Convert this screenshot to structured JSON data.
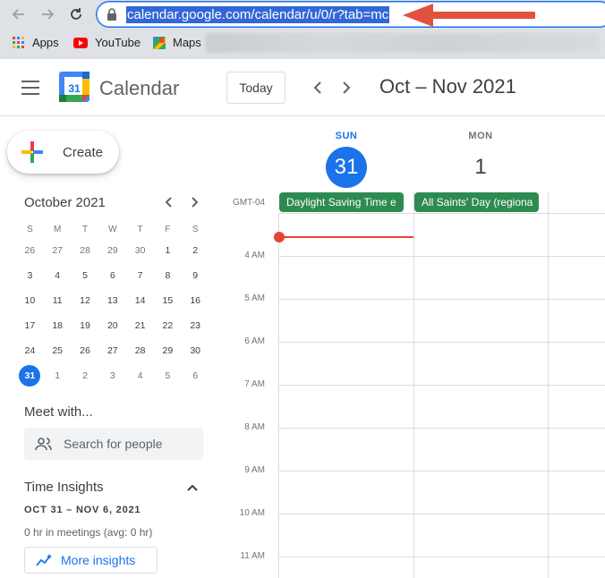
{
  "browser": {
    "url": "calendar.google.com/calendar/u/0/r?tab=mc",
    "bookmarks": [
      {
        "label": "Apps",
        "icon": "apps-grid-icon"
      },
      {
        "label": "YouTube",
        "icon": "youtube-icon"
      },
      {
        "label": "Maps",
        "icon": "maps-icon"
      }
    ]
  },
  "header": {
    "logo_day": "31",
    "app_title": "Calendar",
    "today_label": "Today",
    "date_range": "Oct – Nov 2021"
  },
  "sidebar": {
    "create_label": "Create",
    "mini_calendar": {
      "title": "October 2021",
      "weekdays": [
        "S",
        "M",
        "T",
        "W",
        "T",
        "F",
        "S"
      ],
      "weeks": [
        [
          "26",
          "27",
          "28",
          "29",
          "30",
          "1",
          "2"
        ],
        [
          "3",
          "4",
          "5",
          "6",
          "7",
          "8",
          "9"
        ],
        [
          "10",
          "11",
          "12",
          "13",
          "14",
          "15",
          "16"
        ],
        [
          "17",
          "18",
          "19",
          "20",
          "21",
          "22",
          "23"
        ],
        [
          "24",
          "25",
          "26",
          "27",
          "28",
          "29",
          "30"
        ],
        [
          "31",
          "1",
          "2",
          "3",
          "4",
          "5",
          "6"
        ]
      ],
      "selected": "31"
    },
    "meet_title": "Meet with...",
    "search_placeholder": "Search for people",
    "time_insights": {
      "title": "Time Insights",
      "range": "OCT 31 – NOV 6, 2021",
      "meetings": "0 hr in meetings (avg: 0 hr)",
      "more_label": "More insights"
    }
  },
  "main": {
    "days": [
      {
        "dow": "SUN",
        "num": "31",
        "today": true
      },
      {
        "dow": "MON",
        "num": "1",
        "today": false
      }
    ],
    "timezone": "GMT-04",
    "all_day_events": [
      {
        "title": "Daylight Saving Time e"
      },
      {
        "title": "All Saints' Day (regiona"
      }
    ],
    "hours": [
      "4 AM",
      "5 AM",
      "6 AM",
      "7 AM",
      "8 AM",
      "9 AM",
      "10 AM",
      "11 AM"
    ]
  },
  "colors": {
    "accent": "#1a73e8",
    "event_green": "#2e8b4f",
    "now_red": "#ea4335",
    "annotation_red": "#e0523f"
  }
}
